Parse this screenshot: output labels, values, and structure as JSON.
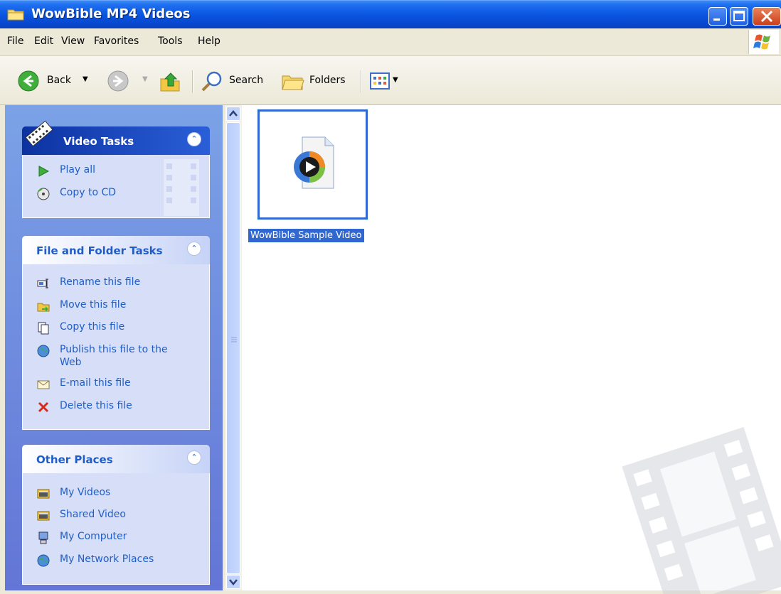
{
  "window": {
    "title": "WowBible MP4 Videos"
  },
  "menu": [
    "File",
    "Edit",
    "View",
    "Favorites",
    "Tools",
    "Help"
  ],
  "toolbar": {
    "back": "Back",
    "search": "Search",
    "folders": "Folders"
  },
  "video_tasks": {
    "title": "Video Tasks",
    "items": [
      "Play all",
      "Copy to CD"
    ]
  },
  "file_folder_tasks": {
    "title": "File and Folder Tasks",
    "items": [
      "Rename this file",
      "Move this file",
      "Copy this file",
      "Publish this file to the",
      "Web",
      "E-mail this file",
      "Delete this file"
    ]
  },
  "other_places": {
    "title": "Other Places",
    "items": [
      "My Videos",
      "Shared Video",
      "My Computer",
      "My Network Places"
    ]
  },
  "files": [
    {
      "name": "WowBible Sample Video"
    }
  ],
  "colors": {
    "titlebar": "#0a55e0",
    "selection": "#3167d0",
    "task_link": "#215dc6"
  }
}
